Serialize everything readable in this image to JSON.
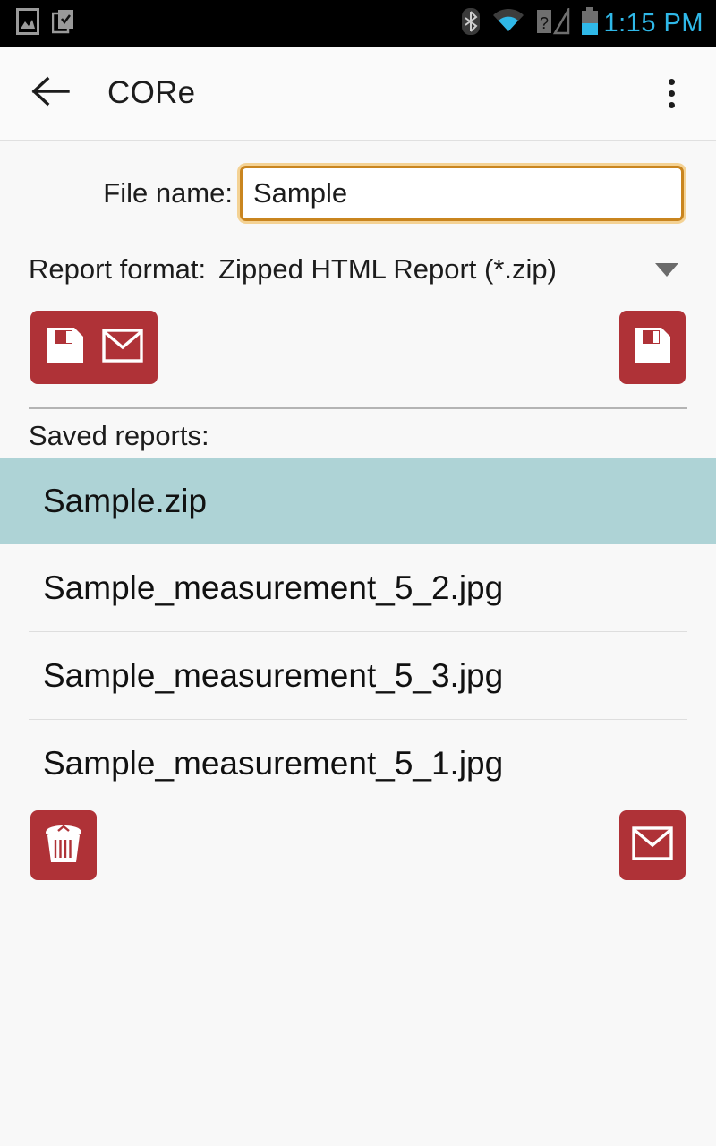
{
  "statusbar": {
    "time": "1:15 PM",
    "left_icons": [
      "image-icon",
      "clipboard-check-icon"
    ],
    "right_icons": [
      "bluetooth-icon",
      "wifi-icon",
      "sim-unknown-icon",
      "battery-icon"
    ],
    "clock_color": "#2fb8e8",
    "background": "#000000"
  },
  "appbar": {
    "back_label": "back-arrow",
    "title": "CORe",
    "overflow_label": "more-options",
    "background": "#fafafa"
  },
  "form": {
    "filename_label": "File name:",
    "filename_value": "Sample",
    "filename_placeholder": "File name",
    "focus_color": "#c9851f",
    "format_label": "Report format:",
    "format_value": "Zipped HTML Report (*.zip)",
    "format_options": [
      "Zipped HTML Report (*.zip)"
    ]
  },
  "actions": {
    "accent_color": "#af3237",
    "save_and_email_label": "save-and-email",
    "save_label": "save",
    "delete_label": "delete",
    "email_label": "email"
  },
  "saved_reports": {
    "label": "Saved reports:",
    "selection_color": "#aed3d6",
    "items": [
      {
        "name": "Sample.zip",
        "selected": true
      },
      {
        "name": "Sample_measurement_5_2.jpg",
        "selected": false
      },
      {
        "name": "Sample_measurement_5_3.jpg",
        "selected": false
      },
      {
        "name": "Sample_measurement_5_1.jpg",
        "selected": false
      }
    ]
  }
}
